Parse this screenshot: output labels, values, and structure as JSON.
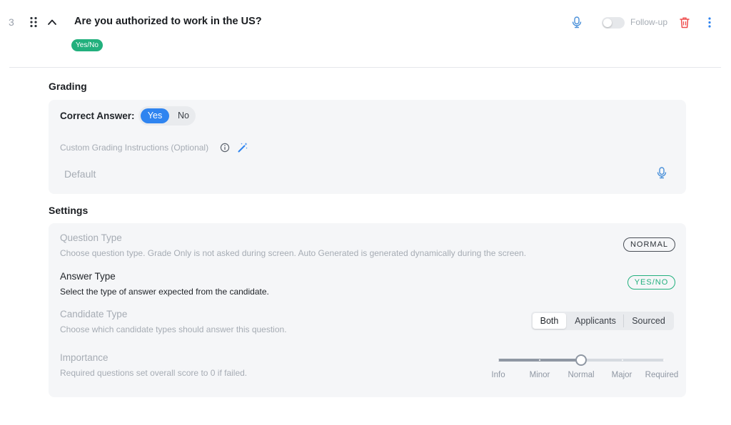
{
  "question": {
    "number": "3",
    "title": "Are you authorized to work in the US?",
    "type_pill": "Yes/No",
    "follow_up_label": "Follow-up",
    "follow_up_enabled": false
  },
  "grading": {
    "section_title": "Grading",
    "correct_answer_label": "Correct Answer:",
    "options": [
      "Yes",
      "No"
    ],
    "selected": "Yes",
    "custom_instructions_label": "Custom Grading Instructions (Optional)",
    "instructions_placeholder": "Default"
  },
  "settings": {
    "section_title": "Settings",
    "question_type": {
      "title": "Question Type",
      "description": "Choose question type. Grade Only is not asked during screen. Auto Generated is generated dynamically during the screen.",
      "value": "NORMAL"
    },
    "answer_type": {
      "title": "Answer Type",
      "description": "Select the type of answer expected from the candidate.",
      "value": "YES/NO"
    },
    "candidate_type": {
      "title": "Candidate Type",
      "description": "Choose which candidate types should answer this question.",
      "options": [
        "Both",
        "Applicants",
        "Sourced"
      ],
      "selected": "Both"
    },
    "importance": {
      "title": "Importance",
      "description": "Required questions set overall score to 0 if failed.",
      "levels": [
        "Info",
        "Minor",
        "Normal",
        "Major",
        "Required"
      ],
      "selected": "Normal",
      "selected_index": 2
    }
  },
  "colors": {
    "accent_blue": "#2f84f0",
    "success_green": "#22b07d",
    "danger_red": "#ef4e4e"
  },
  "icons": [
    "drag-handle-icon",
    "chevron-up-icon",
    "microphone-icon",
    "trash-icon",
    "more-vertical-icon",
    "info-icon",
    "magic-wand-icon"
  ]
}
